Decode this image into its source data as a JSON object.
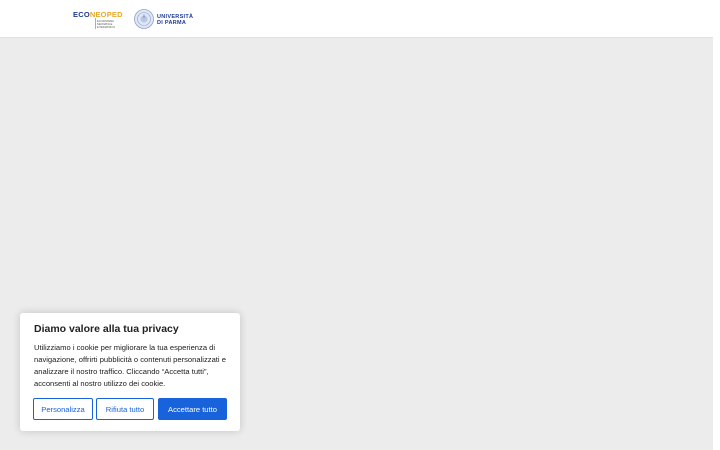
{
  "header": {
    "logo_econeoped": {
      "word_part1": "ECO",
      "word_part2": "NEOPED",
      "subtitle_lines": [
        "ECOSISTEMA",
        "NEONATALE",
        "E PEDIATRICO"
      ]
    },
    "logo_unipr": {
      "line1": "UNIVERSITÀ",
      "line2": "DI PARMA"
    }
  },
  "cookie_banner": {
    "title": "Diamo valore alla tua privacy",
    "text": "Utilizziamo i cookie per migliorare la tua esperienza di navigazione, offrirti pubblicità o contenuti personalizzati e analizzare il nostro traffico. Cliccando “Accetta tutti”, acconsenti al nostro utilizzo dei cookie.",
    "buttons": {
      "customize": "Personalizza",
      "reject": "Rifiuta tutto",
      "accept": "Accettare tutto"
    }
  },
  "colors": {
    "brand_blue": "#1f3a93",
    "brand_gold": "#e8a92a",
    "button_blue": "#1863dc",
    "background": "#ececec"
  }
}
